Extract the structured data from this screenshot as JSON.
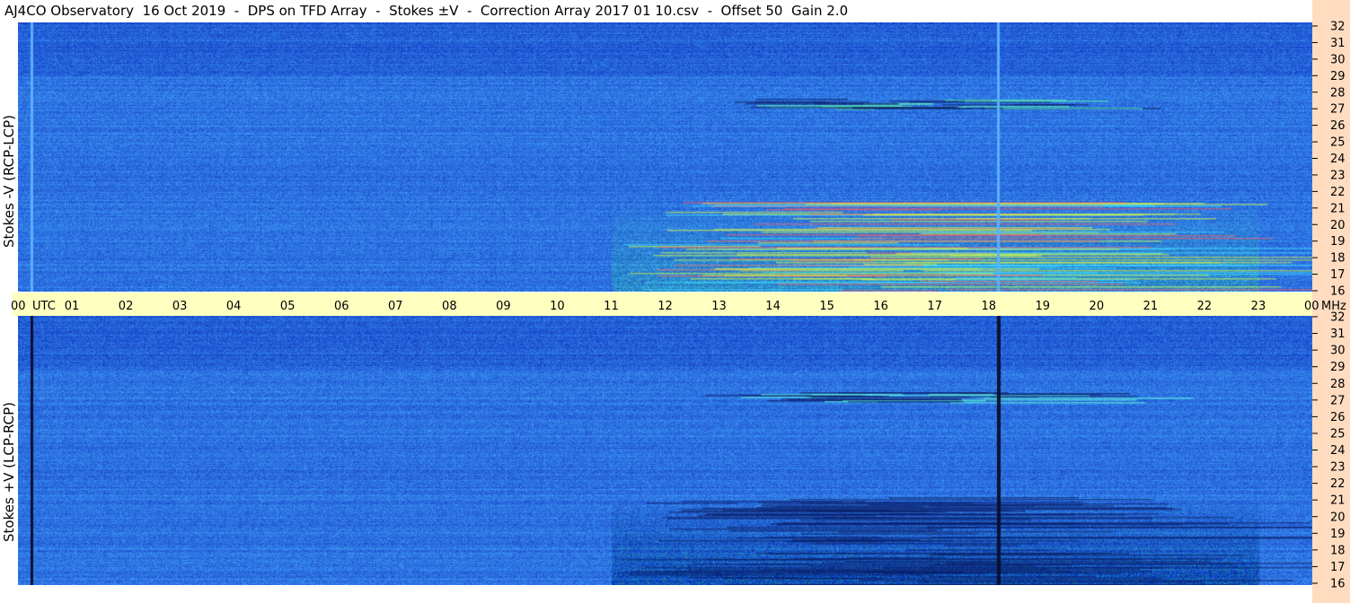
{
  "title": "AJ4CO Observatory  16 Oct 2019  -  DPS on TFD Array  -  Stokes ±V  -  Correction Array 2017 01 10.csv  -  Offset 50  Gain 2.0",
  "colors": {
    "background": "#2f74e0",
    "timebar": "#ffffc0",
    "freqbar": "#ffdcc0",
    "hot": "#e0ff40",
    "cold": "#0a1a60"
  },
  "chart_data": [
    {
      "type": "heatmap",
      "panel": "top",
      "ylabel": "Stokes -V (RCP-LCP)",
      "x_ticks": [
        "00",
        "UTC",
        "01",
        "02",
        "03",
        "04",
        "05",
        "06",
        "07",
        "08",
        "09",
        "10",
        "11",
        "12",
        "13",
        "14",
        "15",
        "16",
        "17",
        "18",
        "19",
        "20",
        "21",
        "22",
        "23",
        "00",
        "MHz"
      ],
      "y_ticks": [
        "16",
        "17",
        "18",
        "19",
        "20",
        "21",
        "22",
        "23",
        "24",
        "25",
        "26",
        "27",
        "28",
        "29",
        "30",
        "31",
        "32"
      ],
      "xlim": [
        0,
        24
      ],
      "ylim": [
        16,
        32
      ]
    },
    {
      "type": "heatmap",
      "panel": "bottom",
      "ylabel": "Stokes +V (LCP-RCP)",
      "y_ticks": [
        "16",
        "17",
        "18",
        "19",
        "20",
        "21",
        "22",
        "23",
        "24",
        "25",
        "26",
        "27",
        "28",
        "29",
        "30",
        "31",
        "32"
      ],
      "xlim": [
        0,
        24
      ],
      "ylim": [
        16,
        32
      ]
    }
  ]
}
